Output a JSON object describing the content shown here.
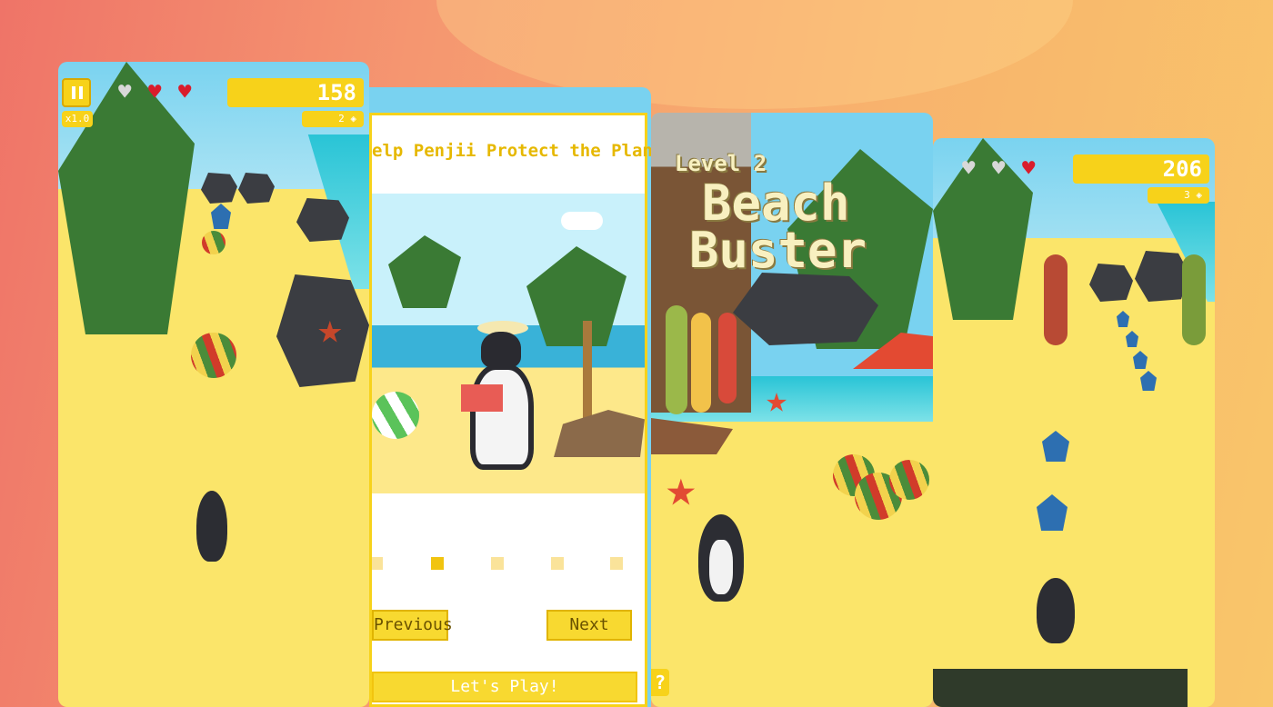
{
  "screen1": {
    "score": "158",
    "gems": "2",
    "multiplier": "x1.0",
    "pause_icon": "pause-icon",
    "hearts": [
      "empty",
      "full",
      "full"
    ]
  },
  "screen2": {
    "title": "elp Penjii Protect the Planet",
    "previous_label": "Previous",
    "next_label": "Next",
    "play_label": "Let's Play!",
    "page_dots": 6,
    "active_dot": 2
  },
  "screen3": {
    "level_label": "Level 2",
    "level_title_line1": "Beach",
    "level_title_line2": "Buster",
    "help_label": "?"
  },
  "screen4": {
    "score": "206",
    "gems": "3",
    "hearts": [
      "empty",
      "empty",
      "full"
    ]
  },
  "colors": {
    "hud_yellow": "#f7d21a",
    "heart_red": "#d91c2b",
    "heart_empty": "#d8d8d8",
    "sand": "#fbe56a"
  }
}
